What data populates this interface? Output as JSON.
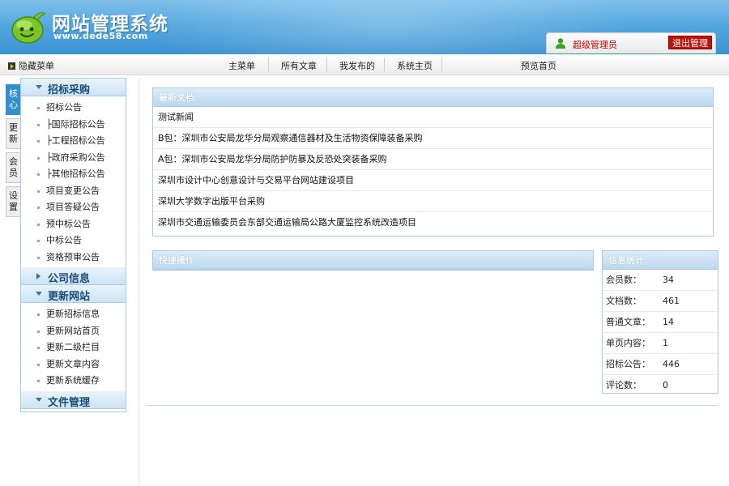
{
  "header": {
    "title": "网站管理系统",
    "url": "www.dede58.com",
    "user_name": "超级管理员",
    "logout_label": "退出管理"
  },
  "navbar": {
    "hide_menu_label": "隐藏菜单",
    "items": [
      "主菜单",
      "所有文章",
      "我发布的",
      "系统主页",
      "预览首页"
    ]
  },
  "side_tabs": [
    "核心",
    "更新",
    "会员",
    "设置"
  ],
  "side_menu": {
    "groups": [
      {
        "label": "招标采购",
        "expanded": true,
        "items": [
          "招标公告",
          "├国际招标公告",
          "├工程招标公告",
          "├政府采购公告",
          "├其他招标公告",
          "项目变更公告",
          "项目答疑公告",
          "预中标公告",
          "中标公告",
          "资格预审公告"
        ]
      },
      {
        "label": "公司信息",
        "expanded": false,
        "items": []
      },
      {
        "label": "更新网站",
        "expanded": true,
        "items": [
          "更新招标信息",
          "更新网站首页",
          "更新二级栏目",
          "更新文章内容",
          "更新系统缓存"
        ]
      },
      {
        "label": "文件管理",
        "expanded": true,
        "items": []
      }
    ]
  },
  "latest_docs": {
    "title": "最新文档",
    "rows": [
      "测试新闻",
      "B包：深圳市公安局龙华分局观察通信器材及生活物资保障装备采购",
      "A包：深圳市公安局龙华分局防护防暴及反恐处突装备采购",
      "深圳市设计中心创意设计与交易平台网站建设项目",
      "深圳大学数字出版平台采购",
      "深圳市交通运输委员会东部交通运输局公路大厦监控系统改造项目"
    ]
  },
  "quick_ops": {
    "title": "快捷操作"
  },
  "stats": {
    "title": "信息统计",
    "rows": [
      {
        "label": "会员数：",
        "value": "34"
      },
      {
        "label": "文档数：",
        "value": "461"
      },
      {
        "label": "普通文章：",
        "value": "14"
      },
      {
        "label": "单页内容：",
        "value": "1"
      },
      {
        "label": "招标公告：",
        "value": "446"
      },
      {
        "label": "评论数：",
        "value": "0"
      }
    ]
  },
  "colors": {
    "header_blue": "#3b92d2",
    "panel_border": "#a9cbe4",
    "logout_red": "#c0120c",
    "active_tab": "#2f8fd0"
  }
}
